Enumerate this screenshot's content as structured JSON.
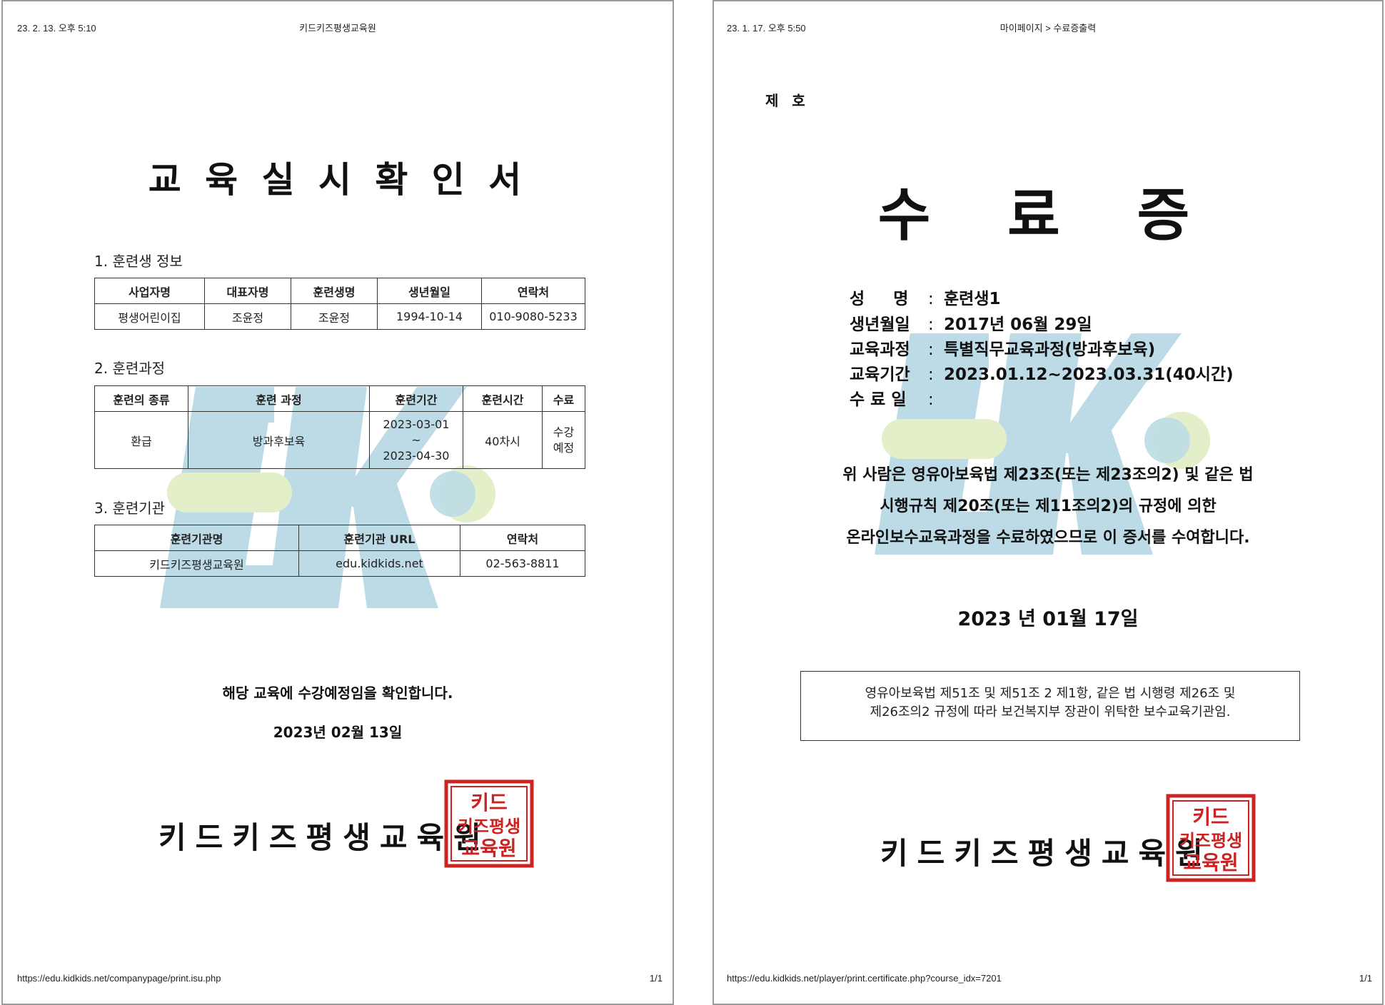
{
  "left_page": {
    "header_datetime": "23. 2. 13. 오후 5:10",
    "header_title": "키드키즈평생교육원",
    "title": "교 육 실 시 확 인 서",
    "section1": {
      "title": "1. 훈련생 정보",
      "headers": [
        "사업자명",
        "대표자명",
        "훈련생명",
        "생년월일",
        "연락처"
      ],
      "row": [
        "평생어린이집",
        "조윤정",
        "조윤정",
        "1994-10-14",
        "010-9080-5233"
      ]
    },
    "section2": {
      "title": "2. 훈련과정",
      "headers": [
        "훈련의 종류",
        "훈련 과정",
        "훈련기간",
        "훈련시간",
        "수료"
      ],
      "row": {
        "type": "환급",
        "course": "방과후보육",
        "period_start": "2023-03-01",
        "period_sep": "~",
        "period_end": "2023-04-30",
        "hours": "40차시",
        "status_line1": "수강",
        "status_line2": "예정"
      }
    },
    "section3": {
      "title": "3. 훈련기관",
      "headers": [
        "훈련기관명",
        "훈련기관 URL",
        "연락처"
      ],
      "row": [
        "키드키즈평생교육원",
        "edu.kidkids.net",
        "02-563-8811"
      ]
    },
    "confirm_text": "해당 교육에 수강예정임을 확인합니다.",
    "date": "2023년 02월 13일",
    "org_name": "키드키즈평생교육원",
    "seal_text": [
      "키드",
      "키즈평생",
      "교육원"
    ],
    "footer_url": "https://edu.kidkids.net/companypage/print.isu.php",
    "footer_page": "1/1"
  },
  "right_page": {
    "header_datetime": "23. 1. 17. 오후 5:50",
    "header_title": "마이페이지 > 수료증출력",
    "number_label": "제 호",
    "title": "수 료 증",
    "fields": [
      {
        "label": "성     명",
        "value": "훈련생1"
      },
      {
        "label": "생년월일",
        "value": "2017년 06월 29일"
      },
      {
        "label": "교육과정",
        "value": "특별직무교육과정(방과후보육)"
      },
      {
        "label": "교육기간",
        "value": "2023.01.12~2023.03.31(40시간)"
      },
      {
        "label": "수 료 일",
        "value": ""
      }
    ],
    "colon": ":",
    "body_lines": [
      "위 사람은 영유아보육법 제23조(또는 제23조의2) 및 같은 법",
      "시행규칙 제20조(또는 제11조의2)의 규정에 의한",
      "온라인보수교육과정을 수료하였으므로 이 증서를 수여합니다."
    ],
    "date": "2023 년 01월 17일",
    "notice_lines": [
      "영유아보육법 제51조 및 제51조 2 제1항, 같은 법 시행령 제26조 및",
      "제26조의2 규정에 따라 보건복지부 장관이 위탁한 보수교육기관임."
    ],
    "org_name": "키드키즈평생교육원",
    "seal_text": [
      "키드",
      "키즈평생",
      "교육원"
    ],
    "footer_url": "https://edu.kidkids.net/player/print.certificate.php?course_idx=7201",
    "footer_page": "1/1"
  },
  "colors": {
    "watermark_blue": "#bcdbe6",
    "watermark_green": "#e3efc9",
    "seal_red": "#cc2222"
  },
  "icons": [
    "kidkids-watermark-logo",
    "official-seal-stamp"
  ]
}
